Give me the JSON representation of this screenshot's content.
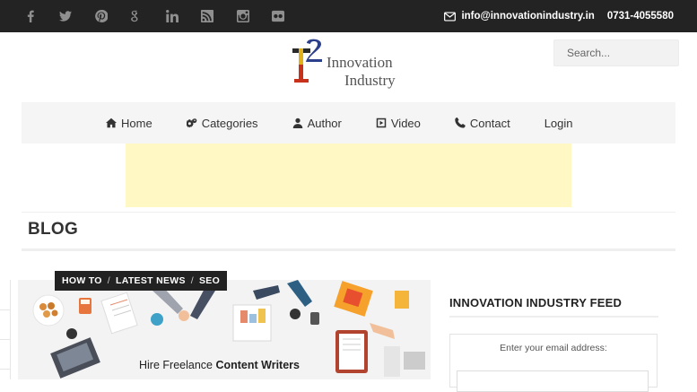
{
  "topbar": {
    "social_icons": [
      "facebook-icon",
      "twitter-icon",
      "pinterest-icon",
      "google-plus-icon",
      "linkedin-icon",
      "rss-icon",
      "instagram-icon",
      "flickr-icon"
    ],
    "email": "info@innovationindustry.in",
    "phone": "0731-4055580"
  },
  "logo": {
    "mark": "T2",
    "line1": "Innovation",
    "line2": "Industry"
  },
  "search": {
    "placeholder": "Search..."
  },
  "nav": [
    {
      "label": "Home",
      "icon": "home-icon"
    },
    {
      "label": "Categories",
      "icon": "gears-icon"
    },
    {
      "label": "Author",
      "icon": "user-icon"
    },
    {
      "label": "Video",
      "icon": "play-icon"
    },
    {
      "label": "Contact",
      "icon": "phone-icon"
    },
    {
      "label": "Login",
      "icon": ""
    }
  ],
  "page": {
    "title": "BLOG"
  },
  "post": {
    "categories": [
      "HOW TO",
      "LATEST NEWS",
      "SEO"
    ],
    "caption_pre": "Hire Freelance ",
    "caption_bold": "Content Writers"
  },
  "sidebar": {
    "feed_title": "INNOVATION INDUSTRY FEED",
    "feed_label": "Enter your email address:"
  },
  "colors": {
    "topbar": "#232323",
    "ad": "#fff8c5",
    "nav_bg": "#f5f5f5"
  }
}
